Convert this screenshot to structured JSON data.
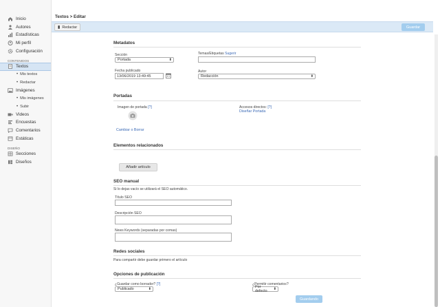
{
  "sidebar": {
    "items": [
      {
        "label": "Inicio",
        "icon": "home-icon"
      },
      {
        "label": "Autores",
        "icon": "user-icon"
      },
      {
        "label": "Estadísticas",
        "icon": "chart-icon"
      },
      {
        "label": "Mi perfil",
        "icon": "profile-icon"
      },
      {
        "label": "Configuración",
        "icon": "gear-icon"
      }
    ],
    "contenidos_header": "CONTENIDOS",
    "textos": {
      "label": "Textos",
      "icon": "document-icon"
    },
    "textos_sub": [
      "Mis textos",
      "Redactar"
    ],
    "imagenes": {
      "label": "Imágenes",
      "icon": "image-icon"
    },
    "imagenes_sub": [
      "Mis imágenes",
      "Subir"
    ],
    "items2": [
      {
        "label": "Videos",
        "icon": "video-icon"
      },
      {
        "label": "Encuestas",
        "icon": "poll-icon"
      },
      {
        "label": "Comentarios",
        "icon": "comment-icon"
      },
      {
        "label": "Estáticas",
        "icon": "static-icon"
      }
    ],
    "diseno_header": "DISEÑO",
    "items3": [
      {
        "label": "Secciones",
        "icon": "sections-icon"
      },
      {
        "label": "Diseños",
        "icon": "layout-icon"
      }
    ]
  },
  "header": {
    "breadcrumb": "Textos > Editar"
  },
  "toolbar": {
    "redactar_label": "Redactar",
    "guardar_label": "Guardar"
  },
  "metadatos": {
    "title": "Metadatos",
    "seccion_label": "Sección",
    "seccion_value": "Portada",
    "temas_label": "Temas/Etiquetas",
    "temas_link": "Sugerir",
    "fecha_label": "Fecha publicado",
    "fecha_value": "13/06/2019 13:49:45",
    "autor_label": "Autor",
    "autor_value": "Redacción"
  },
  "portadas": {
    "title": "Portadas",
    "imagen_label": "Imagen de portada",
    "help": "[?]",
    "accesos_label": "Accesos directos:",
    "disenar_link": "Diseñar Portada",
    "cambiar_link": "Cambiar o Borrar"
  },
  "relacionados": {
    "title": "Elementos relacionados",
    "add_button": "Añadir artículo"
  },
  "seo": {
    "title": "SEO manual",
    "note": "Si lo dejas vacío se utilizará el SEO automático.",
    "titulo_label": "Título SEO",
    "descripcion_label": "Descripción SEO",
    "keywords_label": "News Keywords (separadas por comas)"
  },
  "redes": {
    "title": "Redes sociales",
    "note": "Para compartir debe guardar primero el artículo"
  },
  "publicacion": {
    "title": "Opciones de publicación",
    "borrador_label": "¿Guardar como borrador?",
    "borrador_value": "Publicado",
    "comentarios_label": "¿Permitir comentarios?",
    "comentarios_value": "Por defecto",
    "guardando_label": "Guardando"
  },
  "colors": {
    "accent": "#a3cdee",
    "link": "#3b6ab6",
    "active_bg": "#d6e5f4"
  }
}
